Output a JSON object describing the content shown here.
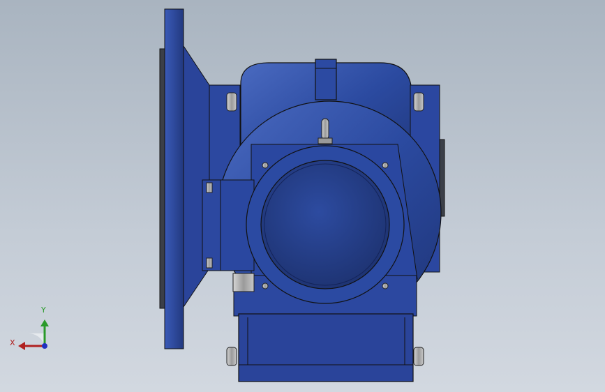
{
  "viewport": {
    "background_top": "#a9b4c0",
    "background_bottom": "#d2d8e0"
  },
  "model": {
    "body_color": "#2b4aa0",
    "body_dark": "#1f3578",
    "body_light": "#4a6ac0",
    "fastener_color": "#b8b8b8"
  },
  "triad": {
    "x_label": "X",
    "y_label": "Y",
    "x_color": "#b02020",
    "y_color": "#2a9a2a",
    "z_color": "#2030c0"
  }
}
